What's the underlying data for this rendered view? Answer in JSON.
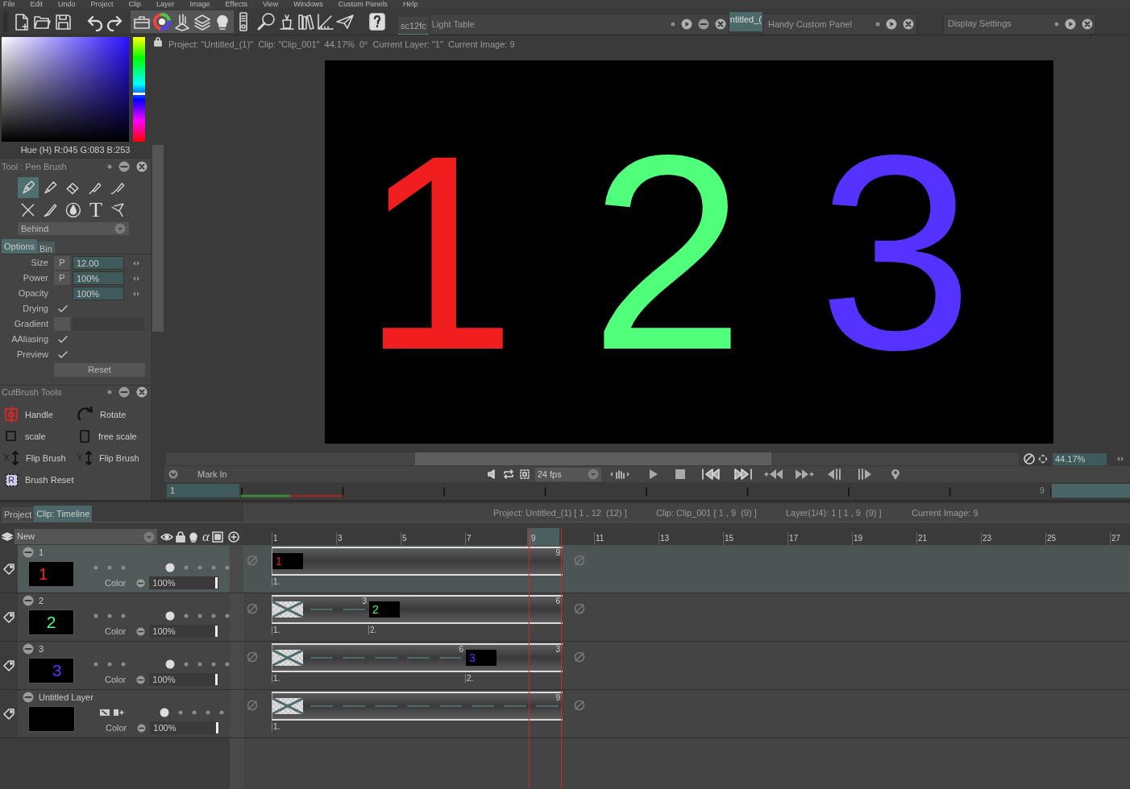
{
  "menu": [
    "File",
    "Edit",
    "Undo",
    "Project",
    "Clip",
    "Layer",
    "Image",
    "Effects",
    "View",
    "Windows",
    "Custom Panels",
    "Help"
  ],
  "top_panels": {
    "tab": "sc12fc",
    "light_table": "Light Table",
    "clip_tab": "ntitled_(",
    "handy": "Handy Custom Panel",
    "display": "Display Settings"
  },
  "color_picker": {
    "readout": "Hue (H) R:045 G:083 B:253"
  },
  "tool_panel": {
    "title": "Tool : Pen Brush",
    "tools": [
      {
        "selected": true
      },
      {
        "selected": false
      },
      {
        "selected": false
      },
      {
        "selected": false
      },
      {
        "selected": false
      },
      {
        "selected": false
      },
      {
        "selected": false
      },
      {
        "selected": false
      },
      {
        "selected": false,
        "glyph": "T"
      },
      {
        "selected": false
      }
    ],
    "blend_mode": "Behind",
    "tabs": [
      {
        "label": "Options",
        "selected": true
      },
      {
        "label": "Bin",
        "selected": false
      }
    ],
    "options": [
      {
        "kind": "number",
        "label": "Size",
        "pressure": "P",
        "value": "12.00"
      },
      {
        "kind": "number",
        "label": "Power",
        "pressure": "P",
        "value": "100%"
      },
      {
        "kind": "number",
        "label": "Opacity",
        "value": "100%"
      },
      {
        "kind": "check",
        "label": "Drying",
        "checked": true
      },
      {
        "kind": "gradient",
        "label": "Gradient"
      },
      {
        "kind": "check",
        "label": "AAliasing",
        "checked": true
      },
      {
        "kind": "check",
        "label": "Preview",
        "checked": true
      }
    ],
    "reset": "Reset"
  },
  "cutbrush": {
    "title": "CutBrush Tools",
    "items": [
      {
        "kind": "handle",
        "label": "Handle"
      },
      {
        "kind": "rotate",
        "label": "Rotate"
      },
      {
        "kind": "scale",
        "label": "scale"
      },
      {
        "kind": "free_scale",
        "label": "free scale"
      },
      {
        "kind": "flip",
        "glyph": "X",
        "label": "Flip Brush"
      },
      {
        "kind": "flip",
        "glyph": "Y",
        "label": "Flip Brush"
      },
      {
        "kind": "reset",
        "glyph": "R",
        "label": "Brush Reset"
      }
    ]
  },
  "canvas": {
    "info": "Project: \"Untitled_(1)\"  Clip: \"Clip_001\"  44.17%  0°  Current Layer: \"1\"  Current Image: 9",
    "digits": [
      {
        "text": "1",
        "color": "#f01e1e"
      },
      {
        "text": "2",
        "color": "#50ff7a"
      },
      {
        "text": "3",
        "color": "#5532ff"
      }
    ],
    "zoom": "44.17%"
  },
  "transport": {
    "mark_in": "Mark In",
    "fps": "24 fps",
    "frame": "1",
    "end_frame": "9"
  },
  "bottom_tabs": [
    {
      "label": "Project",
      "selected": false
    },
    {
      "label": "Clip: Timeline",
      "selected": true
    }
  ],
  "timeline_info": [
    "Project: Untitled_(1) [ 1 , 12  (12) ]",
    "Clip: Clip_001 [ 1 , 9  (9) ]",
    "Layer(1/4): 1 [ 1 , 9  (9) ]",
    "Current Image: 9"
  ],
  "layer_header": {
    "new": "New",
    "alpha": "α"
  },
  "ruler": [
    "1",
    "3",
    "5",
    "7",
    "9",
    "11",
    "13",
    "15",
    "17",
    "19",
    "21",
    "23",
    "25",
    "27"
  ],
  "layers": [
    {
      "name": "1",
      "selected": true,
      "thumb": {
        "text": "1",
        "color": "#f01e1e"
      },
      "blend": "Color",
      "opacity": "100%",
      "segments": [
        {
          "kind": "image",
          "text": "1",
          "color": "#f01e1e",
          "length": "9",
          "mark": "1."
        }
      ]
    },
    {
      "name": "2",
      "selected": false,
      "thumb": {
        "text": "2",
        "color": "#50ff7a"
      },
      "blend": "Color",
      "opacity": "100%",
      "segments": [
        {
          "kind": "empty",
          "length": "3",
          "mark": "1."
        },
        {
          "kind": "image",
          "text": "2",
          "color": "#50ff7a",
          "length": "6",
          "mark": "2."
        }
      ]
    },
    {
      "name": "3",
      "selected": false,
      "thumb": {
        "text": "3",
        "color": "#5532ff"
      },
      "blend": "Color",
      "opacity": "100%",
      "segments": [
        {
          "kind": "empty",
          "length": "6",
          "mark": "1."
        },
        {
          "kind": "image",
          "text": "3",
          "color": "#5532ff",
          "length": "3",
          "mark": "2."
        }
      ]
    },
    {
      "name": "Untitled Layer",
      "selected": false,
      "extra_icons": true,
      "blend": "Color",
      "opacity": "100%",
      "segments": [
        {
          "kind": "empty",
          "length": "9",
          "mark": "1."
        }
      ]
    }
  ]
}
